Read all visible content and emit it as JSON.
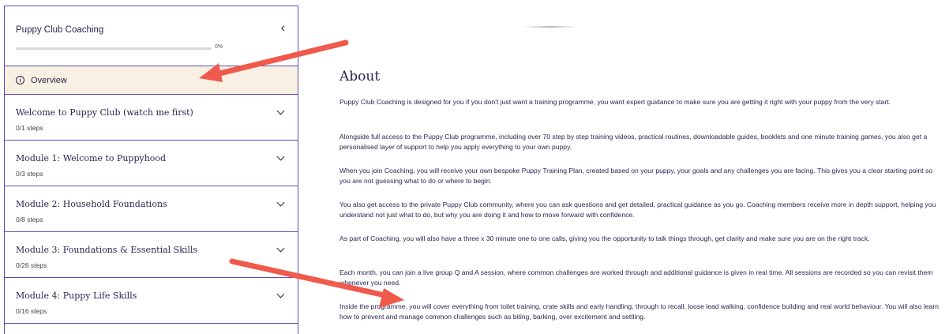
{
  "sidebar": {
    "course_title": "Puppy Club Coaching",
    "progress_percent_label": "0%",
    "progress_fraction": 0,
    "overview_label": "Overview",
    "modules": [
      {
        "title": "Welcome to Puppy Club (watch me first)",
        "steps": "0/1 steps"
      },
      {
        "title": "Module 1: Welcome to Puppyhood",
        "steps": "0/3 steps"
      },
      {
        "title": "Module 2: Household Foundations",
        "steps": "0/8 steps"
      },
      {
        "title": "Module 3: Foundations & Essential Skills",
        "steps": "0/26 steps"
      },
      {
        "title": "Module 4: Puppy Life Skills",
        "steps": "0/16 steps"
      }
    ]
  },
  "main": {
    "heading": "About",
    "paragraphs": [
      "Puppy Club Coaching is designed for you if you don't just want a training programme, you want expert guidance to make sure you are getting it right with your puppy from the very start.",
      "Alongside full access to the Puppy Club programme, including over 70 step by step training videos, practical routines, downloadable guides, booklets and one minute training games, you also get a personalised layer of support to help you apply everything to your own puppy.",
      "When you join Coaching, you will receive your own bespoke Puppy Training Plan, created based on your puppy, your goals and any challenges you are facing. This gives you a clear starting point so you are not guessing what to do or where to begin.",
      "You also get access to the private Puppy Club community, where you can ask questions and get detailed, practical guidance as you go. Coaching members receive more in depth support, helping you understand not just what to do, but why you are doing it and how to move forward with confidence.",
      "As part of Coaching, you will also have a three x 30 minute one to one calls, giving you the opportunity to talk things through, get clarity and make sure you are on the right track.",
      "Each month, you can join a live group Q and A session, where common challenges are worked through and additional guidance is given in real time. All sessions are recorded so you can revisit them whenever you need.",
      "Inside the programme, you will cover everything from toilet training, crate skills and early handling, through to recall, loose lead walking, confidence building and real world behaviour. You will also learn how to prevent and manage common challenges such as biting, barking, over excitement and settling."
    ]
  },
  "colors": {
    "accent": "#5b4db0",
    "overview_bg": "#f8f1e3",
    "annotation_arrow": "#ef5a4c"
  }
}
